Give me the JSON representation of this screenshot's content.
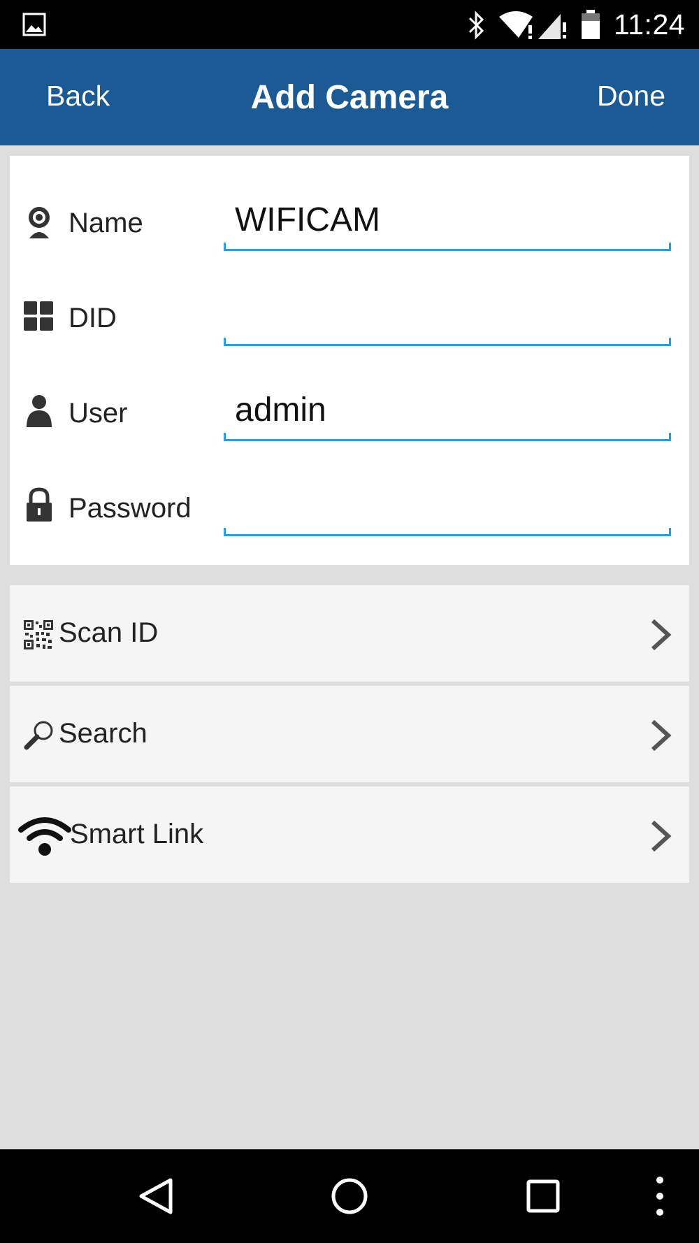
{
  "status_bar": {
    "time": "11:24",
    "icons": [
      "gallery-icon",
      "bluetooth-icon",
      "wifi-alert-icon",
      "cell-signal-alert-icon",
      "battery-icon"
    ]
  },
  "header": {
    "back_label": "Back",
    "title": "Add Camera",
    "done_label": "Done",
    "background_color": "#1b5a94"
  },
  "form": {
    "accent_color": "#2f9be0",
    "fields": [
      {
        "label": "Name",
        "value": "WIFICAM",
        "icon": "webcam-icon"
      },
      {
        "label": "DID",
        "value": "",
        "icon": "grid-icon"
      },
      {
        "label": "User",
        "value": "admin",
        "icon": "user-icon"
      },
      {
        "label": "Password",
        "value": "",
        "icon": "lock-icon"
      }
    ]
  },
  "actions": [
    {
      "label": "Scan ID",
      "icon": "qr-code-icon"
    },
    {
      "label": "Search",
      "icon": "magnifier-icon"
    },
    {
      "label": "Smart Link",
      "icon": "wifi-icon"
    }
  ],
  "nav": {
    "buttons": [
      "back-triangle-icon",
      "home-circle-icon",
      "recents-square-icon",
      "overflow-menu-icon"
    ]
  }
}
